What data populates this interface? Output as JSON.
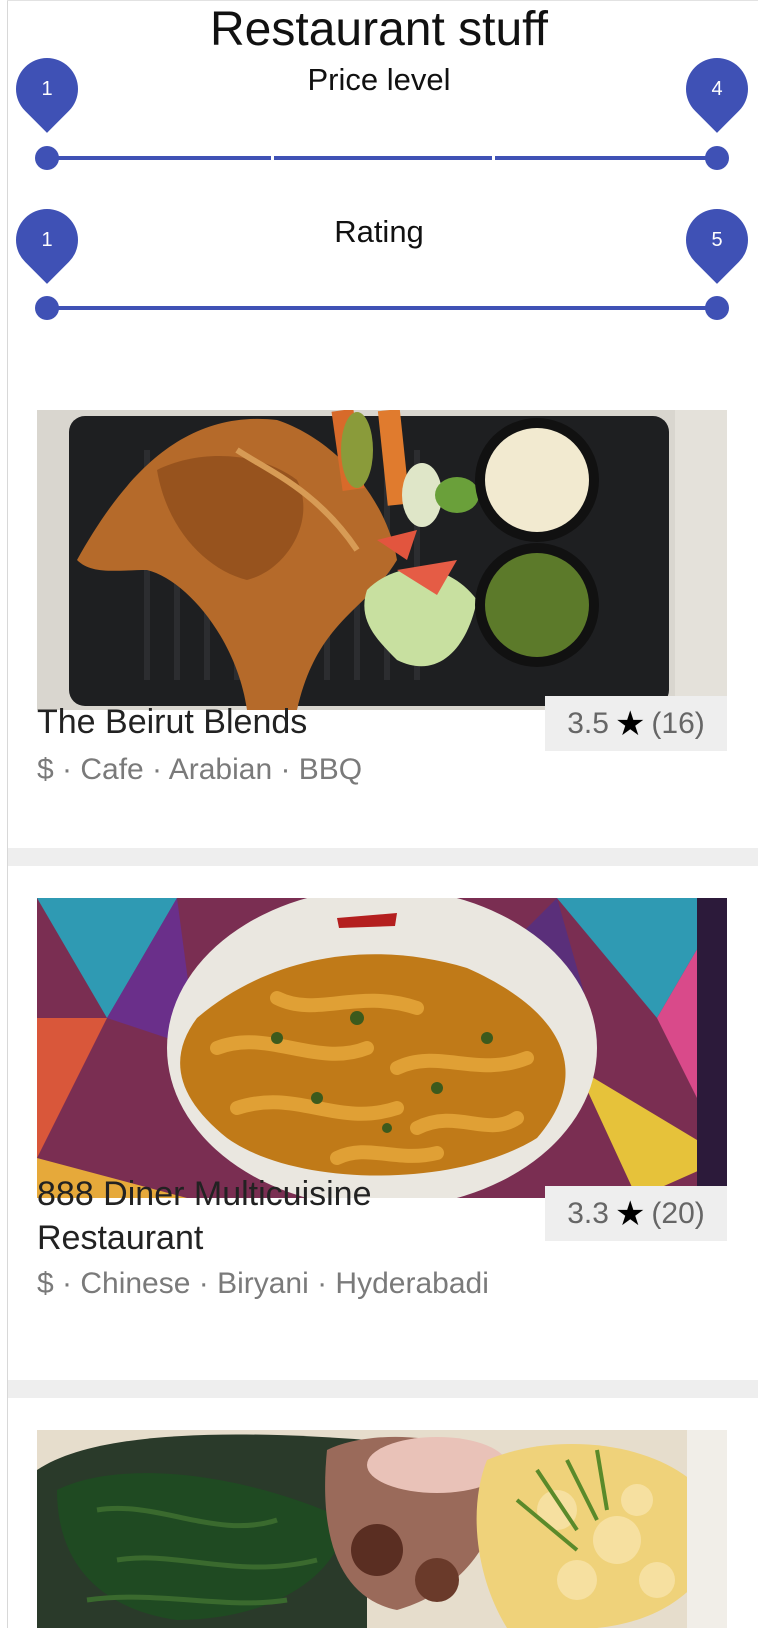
{
  "app": {
    "title": "Restaurant stuff"
  },
  "filters": {
    "price": {
      "label": "Price level",
      "min": "1",
      "max": "4"
    },
    "rating": {
      "label": "Rating",
      "min": "1",
      "max": "5"
    }
  },
  "restaurants": [
    {
      "name": "The Beirut Blends",
      "meta": "$ · Cafe · Arabian · BBQ",
      "rating": "3.5",
      "star": "★",
      "reviews": "(16)",
      "image": "grilled-chicken-platter"
    },
    {
      "name": "888 Diner Multicuisine Restaurant",
      "meta": "$ · Chinese · Biryani · Hyderabadi",
      "rating": "3.3",
      "star": "★",
      "reviews": "(20)",
      "image": "fried-chicken-dish"
    },
    {
      "name": "",
      "meta": "",
      "image": "breakfast-plate"
    }
  ],
  "colors": {
    "accent": "#3f51b5",
    "badge_bg": "#eeeeee",
    "divider": "#eeeeee"
  }
}
